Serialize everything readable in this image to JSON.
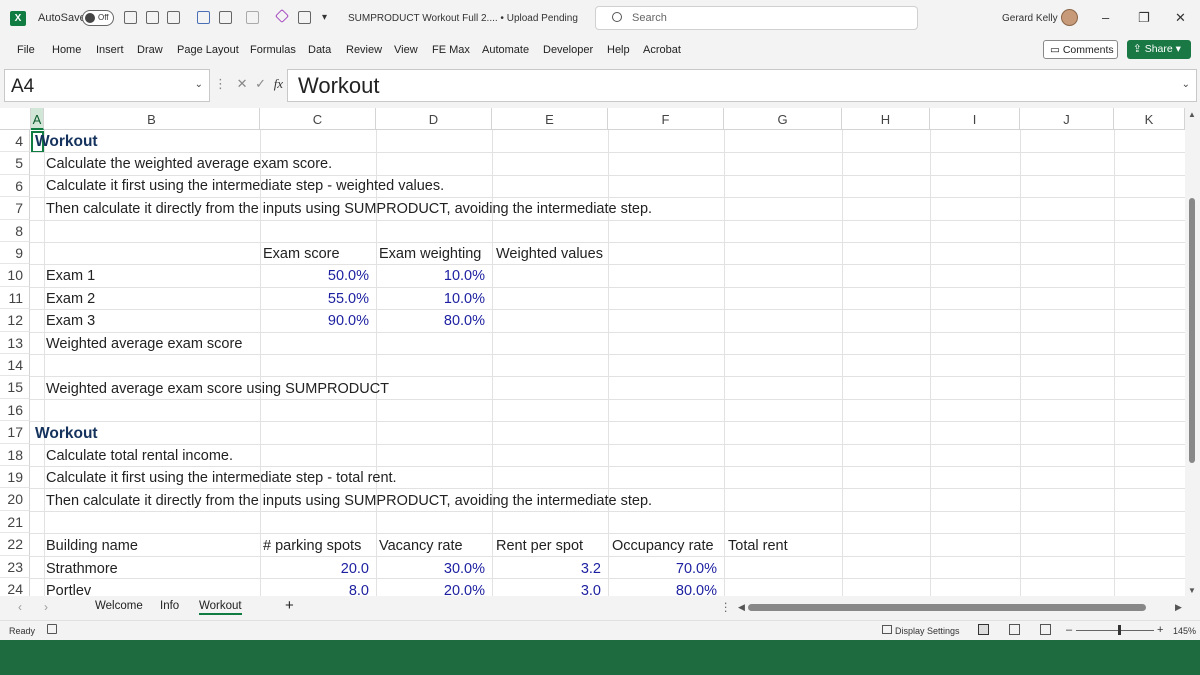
{
  "window": {
    "autosave_label": "AutoSave",
    "autosave_state": "Off",
    "doc_title": "SUMPRODUCT Workout Full 2.... • Upload Pending",
    "search_placeholder": "Search",
    "user_name": "Gerard Kelly"
  },
  "ribbon": {
    "tabs": [
      "File",
      "Home",
      "Insert",
      "Draw",
      "Page Layout",
      "Formulas",
      "Data",
      "Review",
      "View",
      "FE Max",
      "Automate",
      "Developer",
      "Help",
      "Acrobat"
    ],
    "comments_label": "Comments",
    "share_label": "Share"
  },
  "formula_bar": {
    "name_box": "A4",
    "fx_label": "fx",
    "content": "Workout"
  },
  "columns": [
    "A",
    "B",
    "C",
    "D",
    "E",
    "F",
    "G",
    "H",
    "I",
    "J",
    "K"
  ],
  "rows": [
    "4",
    "5",
    "6",
    "7",
    "8",
    "9",
    "10",
    "11",
    "12",
    "13",
    "14",
    "15",
    "16",
    "17",
    "18",
    "19",
    "20",
    "21",
    "22",
    "23",
    "24"
  ],
  "cells": {
    "r4": "Workout",
    "r5": "Calculate the weighted average exam score.",
    "r6": "Calculate it first using the intermediate step - weighted values.",
    "r7": "Then calculate it directly from the inputs using SUMPRODUCT, avoiding the intermediate step.",
    "r9_headers": [
      "Exam score",
      "Exam weighting",
      "Weighted values"
    ],
    "exams": [
      {
        "name": "Exam 1",
        "score": "50.0%",
        "weight": "10.0%"
      },
      {
        "name": "Exam 2",
        "score": "55.0%",
        "weight": "10.0%"
      },
      {
        "name": "Exam 3",
        "score": "90.0%",
        "weight": "80.0%"
      }
    ],
    "r13": "Weighted average exam score",
    "r15": "Weighted average exam score using SUMPRODUCT",
    "r17": "Workout",
    "r18": "Calculate total rental income.",
    "r19": "Calculate it first using the intermediate step - total rent.",
    "r20": "Then calculate it directly from the inputs using SUMPRODUCT, avoiding the intermediate step.",
    "r22_headers": [
      "Building name",
      "# parking spots",
      "Vacancy rate",
      "Rent per spot",
      "Occupancy rate",
      "Total rent"
    ],
    "buildings": [
      {
        "name": "Strathmore",
        "spots": "20.0",
        "vacancy": "30.0%",
        "rent": "3.2",
        "occupancy": "70.0%"
      },
      {
        "name": "Portlev",
        "spots": "8.0",
        "vacancy": "20.0%",
        "rent": "3.0",
        "occupancy": "80.0%"
      }
    ]
  },
  "sheets": [
    "Welcome",
    "Info",
    "Workout"
  ],
  "active_sheet": "Workout",
  "status": {
    "ready": "Ready",
    "display_settings": "Display Settings",
    "zoom": "145%"
  },
  "colors": {
    "accent": "#107c41",
    "input_blue": "#1c1fa0",
    "heading_navy": "#14325c"
  }
}
